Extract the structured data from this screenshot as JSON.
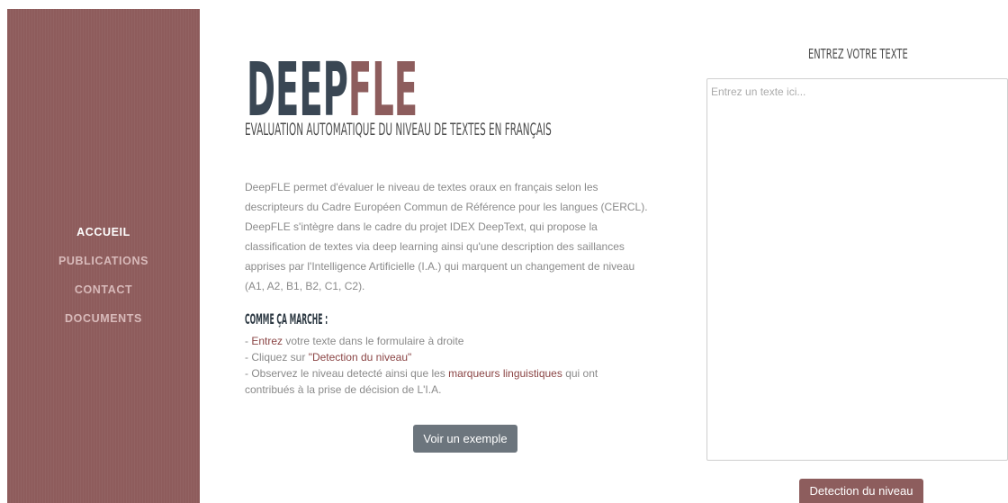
{
  "sidebar": {
    "items": [
      {
        "label": "ACCUEIL",
        "active": true
      },
      {
        "label": "PUBLICATIONS",
        "active": false
      },
      {
        "label": "CONTACT",
        "active": false
      },
      {
        "label": "DOCUMENTS",
        "active": false
      }
    ]
  },
  "brand": {
    "part1": "DEEP",
    "part2": "FLE",
    "subtitle": "EVALUATION AUTOMATIQUE DU NIVEAU DE TEXTES EN FRANÇAIS"
  },
  "intro": {
    "lines": [
      "DeepFLE permet d'évaluer le niveau de textes oraux en français selon les",
      "descripteurs du Cadre Européen Commun de Référence pour les langues (CERCL).",
      "DeepFLE s'intègre dans le cadre du projet IDEX DeepText, qui propose la",
      "classification de textes via deep learning ainsi qu'une description des saillances",
      "apprises par l'Intelligence Artificielle (I.A.) qui marquent un changement de niveau",
      "(A1, A2, B1, B2, C1, C2)."
    ]
  },
  "how_it_works": {
    "heading": "COMME ÇA MARCHE :",
    "steps": [
      {
        "prefix": "- ",
        "link": "Entrez",
        "suffix": " votre texte dans le formulaire à droite"
      },
      {
        "prefix": "- Cliquez sur ",
        "link": "\"Detection du niveau\""
      },
      {
        "prefix": "- Observez le niveau detecté ainsi que les ",
        "link": "marqueurs linguistiques",
        "suffix": " qui ont",
        "continuation": "contribués à la prise de décision de L'I.A."
      }
    ]
  },
  "example_button": {
    "label": "Voir un exemple"
  },
  "input_panel": {
    "heading": "ENTREZ VOTRE TEXTE",
    "placeholder": "Entrez un texte ici...",
    "value": "",
    "submit_label": "Detection du niveau"
  },
  "colors": {
    "brand_dark": "#3a4754",
    "brand_accent": "#8d5d5d",
    "sidebar_bg": "#8e5c5c",
    "nav_active": "#ffffff",
    "nav_inactive": "#d8baba",
    "link": "#8b4545",
    "body_text": "#8a8a8a",
    "example_button_bg": "#6c757d"
  }
}
